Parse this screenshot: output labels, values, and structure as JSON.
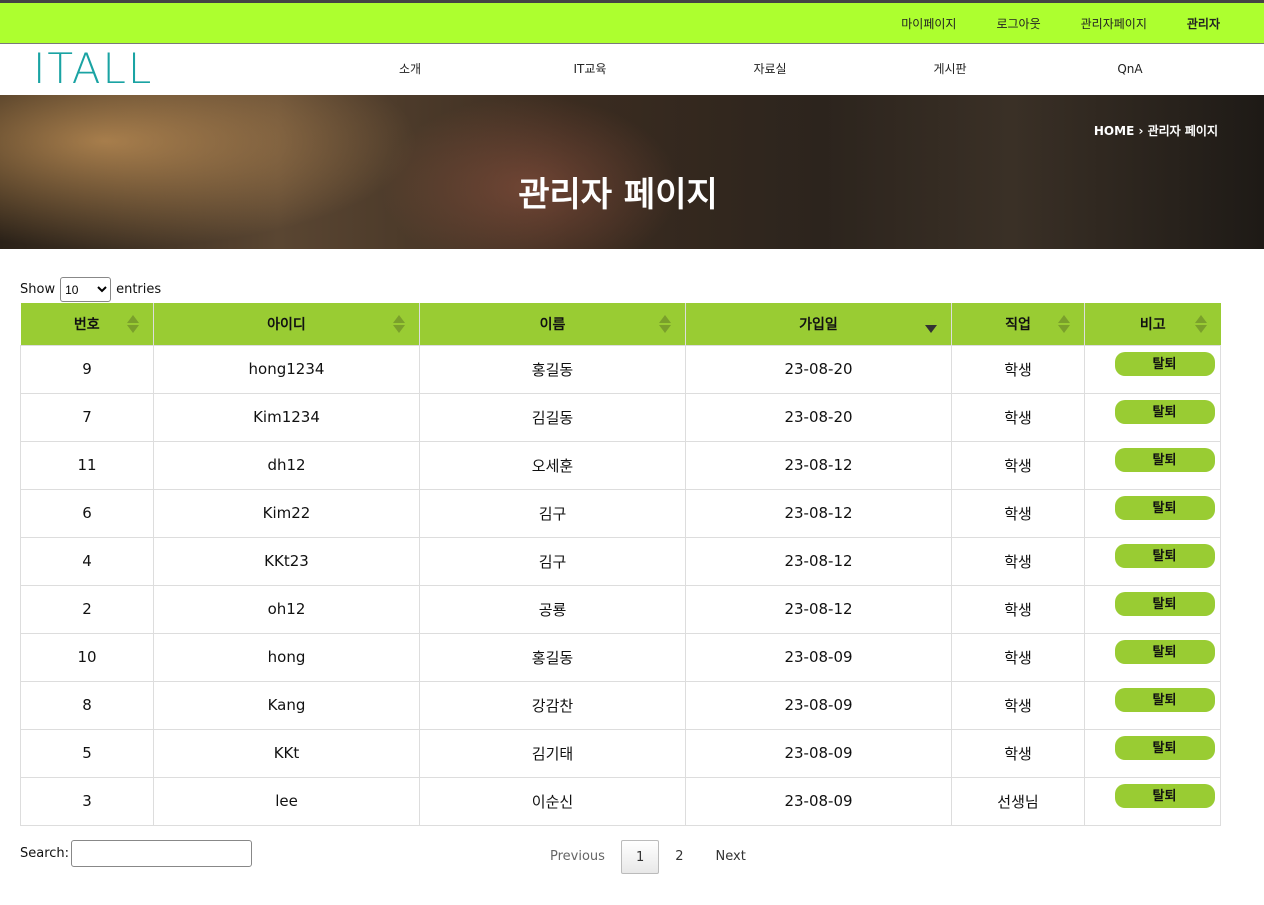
{
  "topbar": {
    "links": [
      "마이페이지",
      "로그아웃",
      "관리자페이지"
    ],
    "admin_name": "관리자"
  },
  "header": {
    "logo": "ITALL",
    "nav": [
      "소개",
      "IT교육",
      "자료실",
      "게시판",
      "QnA"
    ]
  },
  "hero": {
    "title": "관리자 페이지",
    "breadcrumb": "HOME › 관리자 페이지"
  },
  "datatable": {
    "show_label": "Show",
    "entries_label": "entries",
    "page_length": "10",
    "search_label": "Search:",
    "columns": [
      "번호",
      "아이디",
      "이름",
      "가입일",
      "직업",
      "비고"
    ],
    "sorted_column": "가입일",
    "action_label": "탈퇴",
    "rows": [
      [
        "9",
        "hong1234",
        "홍길동",
        "23-08-20",
        "학생"
      ],
      [
        "7",
        "Kim1234",
        "김길동",
        "23-08-20",
        "학생"
      ],
      [
        "11",
        "dh12",
        "오세훈",
        "23-08-12",
        "학생"
      ],
      [
        "6",
        "Kim22",
        "김구",
        "23-08-12",
        "학생"
      ],
      [
        "4",
        "KKt23",
        "김구",
        "23-08-12",
        "학생"
      ],
      [
        "2",
        "oh12",
        "공룡",
        "23-08-12",
        "학생"
      ],
      [
        "10",
        "hong",
        "홍길동",
        "23-08-09",
        "학생"
      ],
      [
        "8",
        "Kang",
        "강감찬",
        "23-08-09",
        "학생"
      ],
      [
        "5",
        "KKt",
        "김기태",
        "23-08-09",
        "학생"
      ],
      [
        "3",
        "lee",
        "이순신",
        "23-08-09",
        "선생님"
      ]
    ]
  },
  "pagination": {
    "previous": "Previous",
    "pages": [
      "1",
      "2"
    ],
    "current": "1",
    "next": "Next"
  },
  "colors": {
    "topbar": "#adff2f",
    "table_header": "#99cc33",
    "button": "#99cc33",
    "logo": "#1aa3a3"
  }
}
